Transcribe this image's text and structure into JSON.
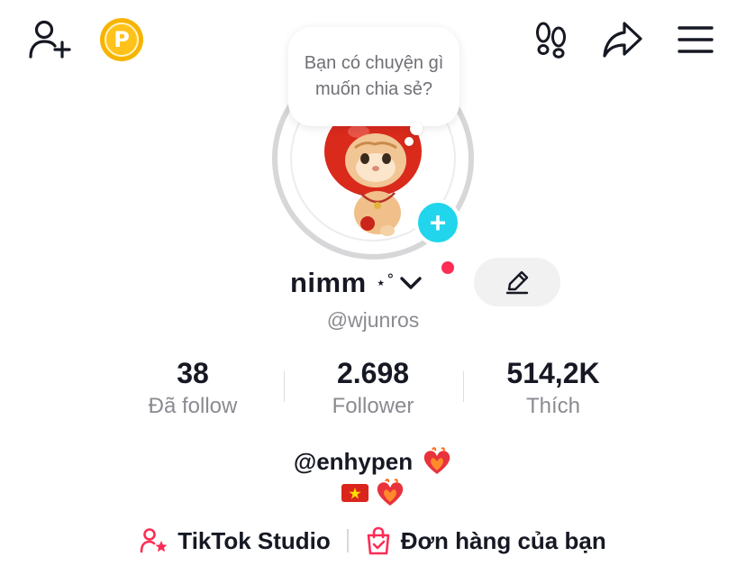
{
  "header": {
    "icons": {
      "add_friend": "person-plus-icon",
      "coin": "coin-icon",
      "footprints": "footprints-icon",
      "share": "share-icon",
      "menu": "hamburger-menu-icon"
    },
    "coin_letter": "P"
  },
  "avatar": {
    "bubble_text": "Bạn có chuyện gì muốn chia sẻ?",
    "add_button_glyph": "+"
  },
  "profile": {
    "display_name": "nimm",
    "name_decoration": "⋆˚ "
  },
  "username": "@wjunros",
  "stats": [
    {
      "value": "38",
      "label": "Đã follow"
    },
    {
      "value": "2.698",
      "label": "Follower"
    },
    {
      "value": "514,2K",
      "label": "Thích"
    }
  ],
  "bio": {
    "line1": "@enhypen",
    "line1_emoji": "❤️‍🔥",
    "line2_flag": "🇻🇳",
    "line2_emoji": "❤️‍🔥"
  },
  "links": {
    "studio_label": "TikTok Studio",
    "orders_label": "Đơn hàng của bạn"
  },
  "colors": {
    "accent_pink": "#fe2c55",
    "add_button": "#20d5ec",
    "coin": "#f6b400",
    "muted_text": "#8a8b91"
  }
}
